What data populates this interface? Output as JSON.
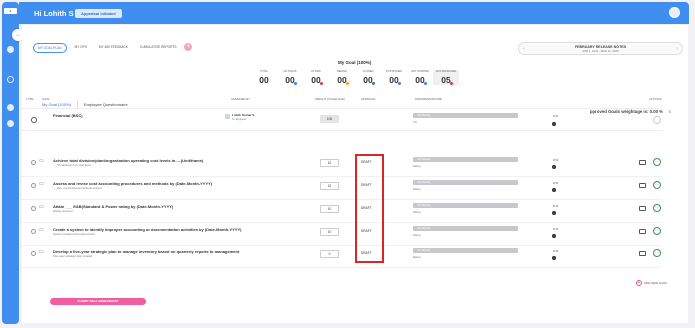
{
  "header": {
    "greeting": "Hi Lohith S",
    "status_badge": "Appraisal initiated"
  },
  "subnav": {
    "items": [
      "MY GOAL PLAN",
      "MY OPS",
      "MY 360 FEEDBACK",
      "CUMULATIVE REPORTS"
    ],
    "add": "+"
  },
  "release": {
    "title": "FEBRUARY RELEASE NOTES",
    "dates": "APR 1, 2024 - MAR 31, 2025"
  },
  "goal_summary": {
    "title": "My Goal (100%)",
    "stats": [
      {
        "label": "TOTAL",
        "value": "00",
        "dot": ""
      },
      {
        "label": "ON TRACK",
        "value": "00",
        "dot": "#3b82f6"
      },
      {
        "label": "AT RISK",
        "value": "00",
        "dot": "#e53935"
      },
      {
        "label": "BEHIND",
        "value": "00",
        "dot": "#f5a623"
      },
      {
        "label": "CLOSED",
        "value": "00",
        "dot": "#2e8b57"
      },
      {
        "label": "POSTPONED",
        "value": "00",
        "dot": "#3b82f6"
      },
      {
        "label": "NOT STARTED",
        "value": "00",
        "dot": "#3b82f6"
      },
      {
        "label": "NOT APPROVED",
        "value": "05",
        "dot": "#e53935"
      }
    ]
  },
  "tabs": [
    "My Goal (100%)",
    "Employee Questionnaire"
  ],
  "weightage": "pproved Goals weightage is: 0.00 %",
  "table": {
    "headers": {
      "type": "TYPE",
      "goal": "GOAL",
      "assigned_by": "ASSIGNED BY",
      "weight": "WEIGHT (TOLER-NCE)",
      "approval": "APPROVAL",
      "progress": "PROGRESS/SCORE",
      "actions": "ACTIONS"
    },
    "parent": {
      "title": "Financial (BSC)",
      "assignee": "Lohith Kumar S",
      "role": "Sr. Engineer",
      "weight": "100",
      "progress": "Not Started",
      "progress_sub": "0%",
      "pct": "0 %"
    },
    "rows": [
      {
        "title": "Achieve total division/plant/organization operating cost levels in.....(Unit/frame)",
        "sub": "..._*% variance from cost level",
        "weight": "10",
        "approval": "DRAFT",
        "progress": "Not Started",
        "rating": "Rating",
        "pct": "0 %"
      },
      {
        "title": "Assess and revise cost accounting procedures and methods by (Date-Month-YYYY)",
        "sub": "..._Rev. of procedures/methods revised",
        "weight": "10",
        "approval": "DRAFT",
        "progress": "Not Started",
        "rating": "Rating",
        "pct": "0 %"
      },
      {
        "title": "Attain ___ E&B(Standard & Power rating by (Date-Month-YYYY)",
        "sub": "Rating received",
        "weight": "10",
        "approval": "DRAFT",
        "progress": "Not Started",
        "rating": "Rating",
        "pct": "0 %"
      },
      {
        "title": "Create a system to identify improper accounting or documentation activities by (Date-Month-YYYY)",
        "sub": "System created and implemented",
        "weight": "10",
        "approval": "DRAFT",
        "progress": "Not Started",
        "rating": "Rating",
        "pct": "0 %"
      },
      {
        "title": "Develop a five-year strategic plan to manage inventory based on quarterly reports to management",
        "sub": "Five-year strategic plan created",
        "weight": "0",
        "approval": "DRAFT",
        "progress": "Not Started",
        "rating": "Rating",
        "pct": "0 %"
      }
    ]
  },
  "add_goal": "ADD NEW GOAL",
  "submit": "SUBMIT SELF ASSESSMENT"
}
